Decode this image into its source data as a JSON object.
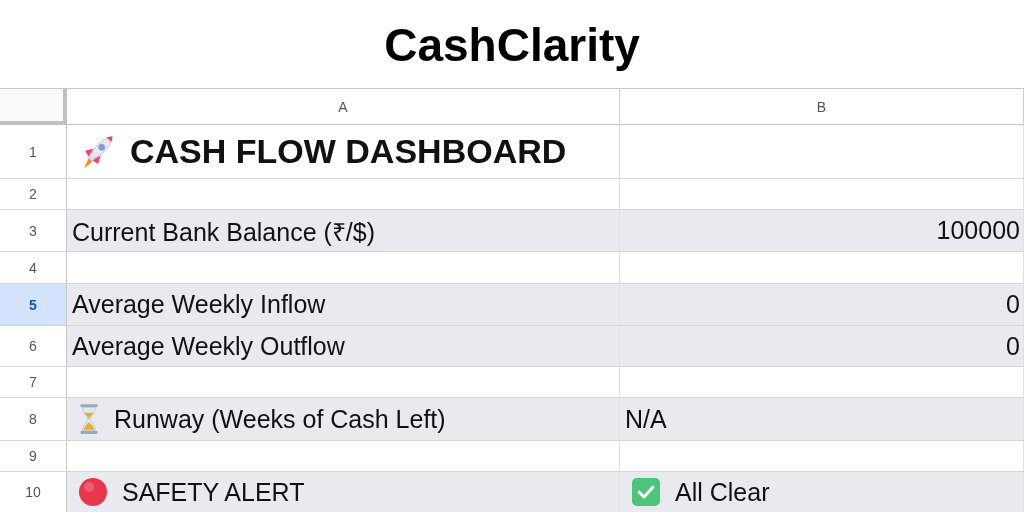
{
  "page_title": "CashClarity",
  "columns": [
    "A",
    "B"
  ],
  "rows": [
    {
      "number": "1",
      "selected": false,
      "kind": "heading",
      "cells": [
        "CASH FLOW DASHBOARD"
      ]
    },
    {
      "number": "2",
      "selected": false,
      "kind": "empty",
      "cells": []
    },
    {
      "number": "3",
      "selected": false,
      "kind": "value",
      "cells": [
        "Current Bank Balance (₹/$)",
        "100000"
      ]
    },
    {
      "number": "4",
      "selected": false,
      "kind": "empty",
      "cells": []
    },
    {
      "number": "5",
      "selected": true,
      "kind": "value",
      "cells": [
        "Average Weekly Inflow",
        "0"
      ]
    },
    {
      "number": "6",
      "selected": false,
      "kind": "value",
      "cells": [
        "Average Weekly Outflow",
        "0"
      ]
    },
    {
      "number": "7",
      "selected": false,
      "kind": "empty",
      "cells": []
    },
    {
      "number": "8",
      "selected": false,
      "kind": "runway",
      "cells": [
        "Runway (Weeks of Cash Left)",
        "N/A"
      ]
    },
    {
      "number": "9",
      "selected": false,
      "kind": "empty",
      "cells": []
    },
    {
      "number": "10",
      "selected": false,
      "kind": "alert",
      "cells": [
        "SAFETY ALERT",
        "All Clear"
      ]
    }
  ]
}
